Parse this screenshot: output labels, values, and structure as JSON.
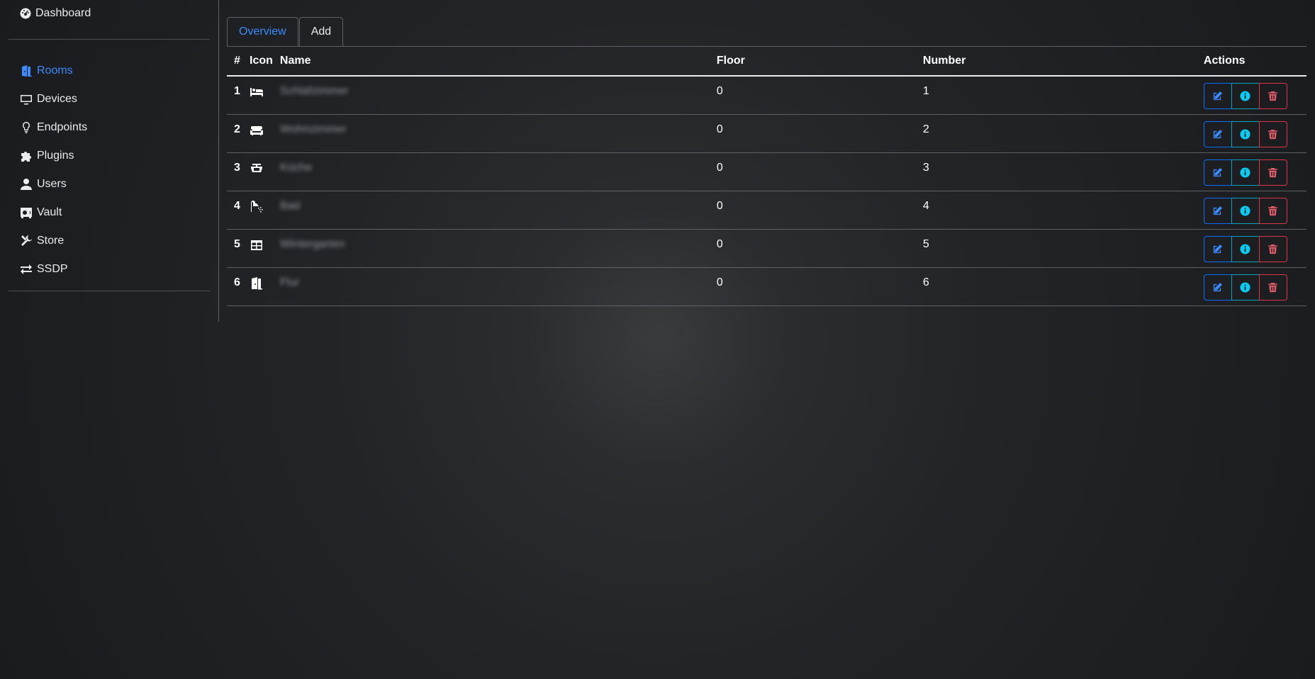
{
  "sidebar": {
    "dashboard": {
      "label": "Dashboard",
      "icon": "dashboard-gauge-icon"
    },
    "items": [
      {
        "label": "Rooms",
        "icon": "door-open-icon",
        "active": true
      },
      {
        "label": "Devices",
        "icon": "monitor-icon"
      },
      {
        "label": "Endpoints",
        "icon": "lightbulb-icon"
      },
      {
        "label": "Plugins",
        "icon": "puzzle-icon"
      },
      {
        "label": "Users",
        "icon": "user-icon"
      },
      {
        "label": "Vault",
        "icon": "vault-icon"
      },
      {
        "label": "Store",
        "icon": "tools-icon"
      },
      {
        "label": "SSDP",
        "icon": "exchange-arrows-icon"
      }
    ]
  },
  "tabs": [
    {
      "label": "Overview",
      "active": true
    },
    {
      "label": "Add"
    }
  ],
  "table": {
    "headers": {
      "num": "#",
      "icon": "Icon",
      "name": "Name",
      "floor": "Floor",
      "number": "Number",
      "actions": "Actions"
    },
    "rows": [
      {
        "num": "1",
        "icon": "bed-icon",
        "name": "Schlafzimmer",
        "floor": "0",
        "number": "1"
      },
      {
        "num": "2",
        "icon": "couch-icon",
        "name": "Wohnzimmer",
        "floor": "0",
        "number": "2"
      },
      {
        "num": "3",
        "icon": "sink-icon",
        "name": "Küche",
        "floor": "0",
        "number": "3"
      },
      {
        "num": "4",
        "icon": "shower-icon",
        "name": "Bad",
        "floor": "0",
        "number": "4"
      },
      {
        "num": "5",
        "icon": "table-icon",
        "name": "Wintergarten",
        "floor": "0",
        "number": "5"
      },
      {
        "num": "6",
        "icon": "door-open-icon",
        "name": "Flur",
        "floor": "0",
        "number": "6"
      }
    ]
  },
  "colors": {
    "accent": "#3d8bfd",
    "info": "#0dcaf0",
    "danger": "#dc3545",
    "background": "#222427"
  }
}
